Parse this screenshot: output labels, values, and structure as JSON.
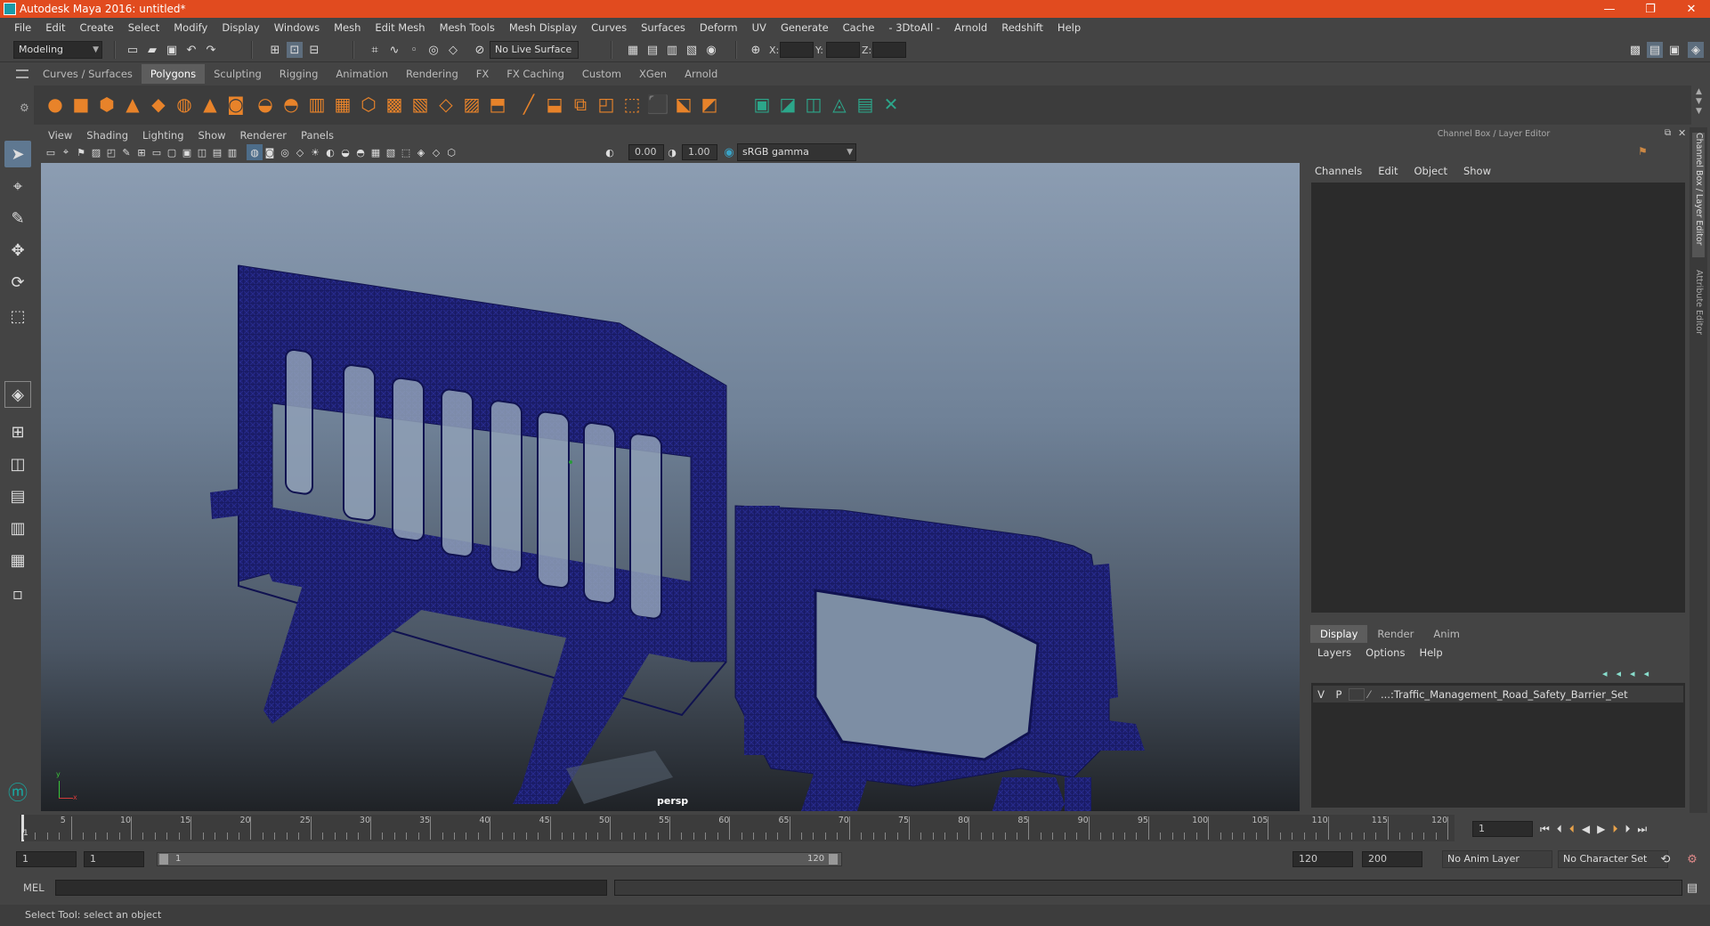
{
  "window": {
    "title": "Autodesk Maya 2016: untitled*"
  },
  "menus": [
    "File",
    "Edit",
    "Create",
    "Select",
    "Modify",
    "Display",
    "Windows",
    "Mesh",
    "Edit Mesh",
    "Mesh Tools",
    "Mesh Display",
    "Curves",
    "Surfaces",
    "Deform",
    "UV",
    "Generate",
    "Cache",
    "- 3DtoAll -",
    "Arnold",
    "Redshift",
    "Help"
  ],
  "status_line": {
    "mode": "Modeling",
    "live_surface": "No Live Surface",
    "x_label": "X:",
    "y_label": "Y:",
    "z_label": "Z:"
  },
  "shelf_tabs": [
    "Curves / Surfaces",
    "Polygons",
    "Sculpting",
    "Rigging",
    "Animation",
    "Rendering",
    "FX",
    "FX Caching",
    "Custom",
    "XGen",
    "Arnold"
  ],
  "shelf_active": "Polygons",
  "viewport": {
    "menus": [
      "View",
      "Shading",
      "Lighting",
      "Show",
      "Renderer",
      "Panels"
    ],
    "exposure": "0.00",
    "gamma": "1.00",
    "color_space": "sRGB gamma",
    "camera_label": "persp"
  },
  "channel_box": {
    "header": "Channel Box / Layer Editor",
    "menus": [
      "Channels",
      "Edit",
      "Object",
      "Show"
    ]
  },
  "layer_editor": {
    "tabs": [
      "Display",
      "Render",
      "Anim"
    ],
    "active_tab": "Display",
    "menus": [
      "Layers",
      "Options",
      "Help"
    ],
    "layers": [
      {
        "v": "V",
        "p": "P",
        "name": "...:Traffic_Management_Road_Safety_Barrier_Set"
      }
    ]
  },
  "side_tabs": [
    "Channel Box / Layer Editor",
    "Attribute Editor"
  ],
  "timeline": {
    "ticks": [
      "5",
      "10",
      "15",
      "20",
      "25",
      "30",
      "35",
      "40",
      "45",
      "50",
      "55",
      "60",
      "65",
      "70",
      "75",
      "80",
      "85",
      "90",
      "95",
      "100",
      "105",
      "110",
      "115",
      "120"
    ],
    "current_frame": "1",
    "start_marker": "1"
  },
  "range": {
    "start": "1",
    "playback_start": "1",
    "slider_start": "1",
    "slider_end": "120",
    "playback_end": "120",
    "end": "200",
    "anim_layer": "No Anim Layer",
    "character_set": "No Character Set"
  },
  "command_line": {
    "label": "MEL"
  },
  "help_line": {
    "text": "Select Tool: select an object"
  }
}
